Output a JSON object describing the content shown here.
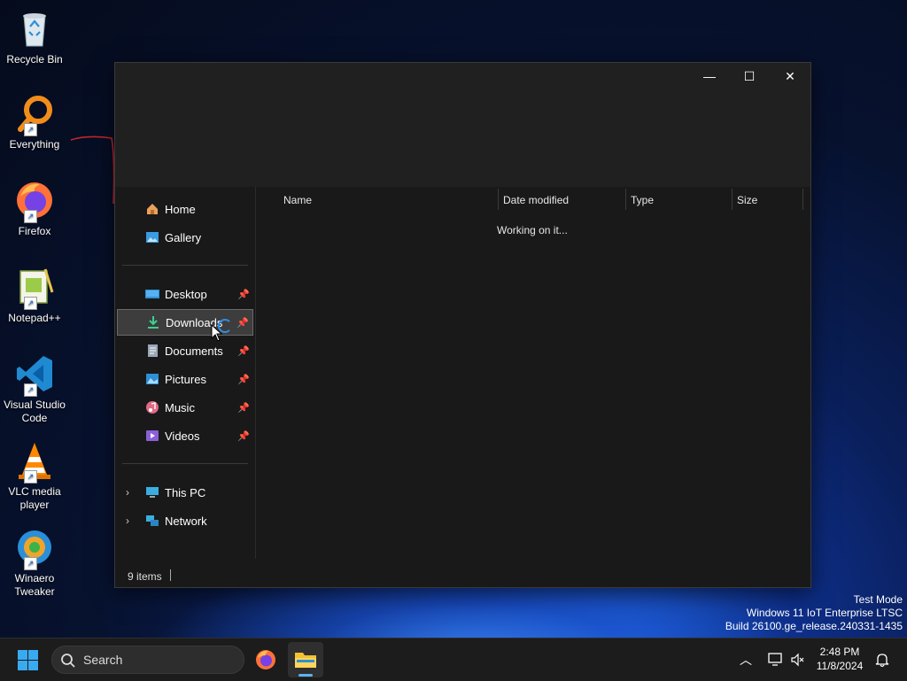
{
  "desktop": {
    "icons": [
      {
        "label": "Recycle Bin",
        "icon": "recycle-bin-icon"
      },
      {
        "label": "Everything",
        "icon": "everything-search-icon"
      },
      {
        "label": "Firefox",
        "icon": "firefox-icon"
      },
      {
        "label": "Notepad++",
        "icon": "notepad-plus-plus-icon"
      },
      {
        "label": "Visual Studio Code",
        "icon": "vscode-icon"
      },
      {
        "label": "VLC media player",
        "icon": "vlc-icon"
      },
      {
        "label": "Winaero Tweaker",
        "icon": "winaero-tweaker-icon"
      }
    ]
  },
  "window": {
    "controls": {
      "minimize": "—",
      "maximize": "☐",
      "close": "✕"
    },
    "nav": {
      "items": [
        {
          "label": "Home",
          "icon": "home-icon"
        },
        {
          "label": "Gallery",
          "icon": "gallery-icon"
        },
        {
          "label": "Desktop",
          "icon": "desktop-folder-icon",
          "pinned": true
        },
        {
          "label": "Downloads",
          "icon": "downloads-folder-icon",
          "pinned": true,
          "selected": true
        },
        {
          "label": "Documents",
          "icon": "documents-folder-icon",
          "pinned": true
        },
        {
          "label": "Pictures",
          "icon": "pictures-folder-icon",
          "pinned": true
        },
        {
          "label": "Music",
          "icon": "music-folder-icon",
          "pinned": true
        },
        {
          "label": "Videos",
          "icon": "videos-folder-icon",
          "pinned": true
        },
        {
          "label": "This PC",
          "icon": "this-pc-icon",
          "expandable": true
        },
        {
          "label": "Network",
          "icon": "network-icon",
          "expandable": true
        }
      ]
    },
    "columns": [
      "Name",
      "Date modified",
      "Type",
      "Size"
    ],
    "status_message": "Working on it...",
    "status_bar": {
      "item_count": "9 items"
    }
  },
  "watermark": {
    "line1": "Test Mode",
    "line2": "Windows 11 IoT Enterprise LTSC",
    "line3": "Build 26100.ge_release.240331-1435"
  },
  "taskbar": {
    "search_placeholder": "Search",
    "clock": {
      "time": "2:48 PM",
      "date": "11/8/2024"
    }
  },
  "colors": {
    "accent": "#0078d4",
    "window_bg": "#191919",
    "selected_bg": "#3d3d3d",
    "taskbar_bg": "#1c1c1c"
  }
}
